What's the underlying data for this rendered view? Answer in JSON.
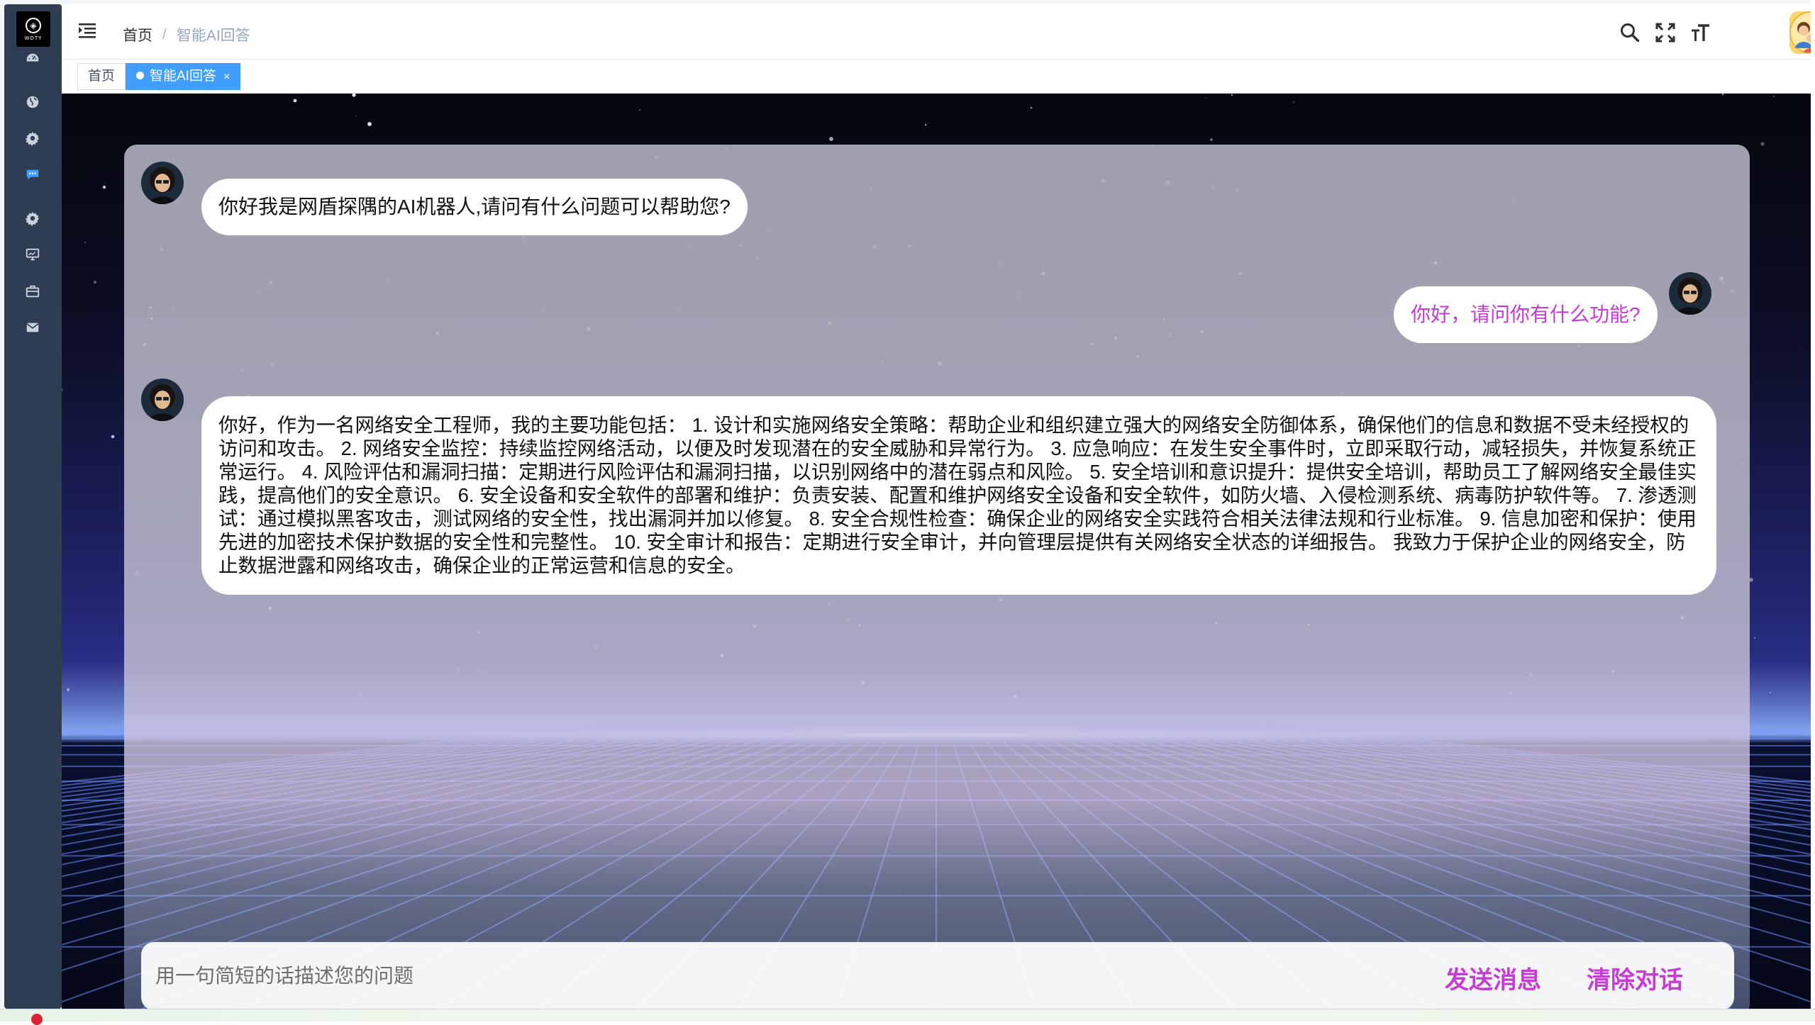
{
  "logo": {
    "text": "WDTY"
  },
  "sidebar": {
    "items": [
      {
        "icon": "dashboard-icon"
      },
      {
        "icon": "globe-icon"
      },
      {
        "icon": "gear-icon"
      },
      {
        "icon": "chat-icon"
      },
      {
        "icon": "gear-icon"
      },
      {
        "icon": "monitor-icon"
      },
      {
        "icon": "briefcase-icon"
      },
      {
        "icon": "mail-icon"
      }
    ]
  },
  "breadcrumb": {
    "home": "首页",
    "separator": "/",
    "current": "智能AI回答"
  },
  "toolbar": {
    "icons": [
      "search-icon",
      "fullscreen-icon",
      "font-size-icon"
    ]
  },
  "tags": [
    {
      "label": "首页",
      "active": false
    },
    {
      "label": "智能AI回答",
      "active": true,
      "close": "×"
    }
  ],
  "chat": {
    "messages": [
      {
        "role": "bot",
        "text": "你好我是网盾探隅的AI机器人,请问有什么问题可以帮助您?"
      },
      {
        "role": "user",
        "text": "你好，请问你有什么功能?"
      },
      {
        "role": "bot",
        "text": "你好，作为一名网络安全工程师，我的主要功能包括： 1. 设计和实施网络安全策略：帮助企业和组织建立强大的网络安全防御体系，确保他们的信息和数据不受未经授权的访问和攻击。 2. 网络安全监控：持续监控网络活动，以便及时发现潜在的安全威胁和异常行为。 3. 应急响应：在发生安全事件时，立即采取行动，减轻损失，并恢复系统正常运行。 4. 风险评估和漏洞扫描：定期进行风险评估和漏洞扫描，以识别网络中的潜在弱点和风险。 5. 安全培训和意识提升：提供安全培训，帮助员工了解网络安全最佳实践，提高他们的安全意识。 6. 安全设备和安全软件的部署和维护：负责安装、配置和维护网络安全设备和安全软件，如防火墙、入侵检测系统、病毒防护软件等。 7. 渗透测试：通过模拟黑客攻击，测试网络的安全性，找出漏洞并加以修复。 8. 安全合规性检查：确保企业的网络安全实践符合相关法律法规和行业标准。 9. 信息加密和保护：使用先进的加密技术保护数据的安全性和完整性。 10. 安全审计和报告：定期进行安全审计，并向管理层提供有关网络安全状态的详细报告。 我致力于保护企业的网络安全，防止数据泄露和网络攻击，确保企业的正常运营和信息的安全。"
      }
    ]
  },
  "input": {
    "placeholder": "用一句简短的话描述您的问题",
    "value": ""
  },
  "buttons": {
    "send": "发送消息",
    "clear": "清除对话"
  },
  "colors": {
    "sidebar_bg": "#2e3d52",
    "active_tag": "#409eff",
    "accent_magenta": "#c63bd4",
    "breadcrumb_current": "#97a8be"
  }
}
